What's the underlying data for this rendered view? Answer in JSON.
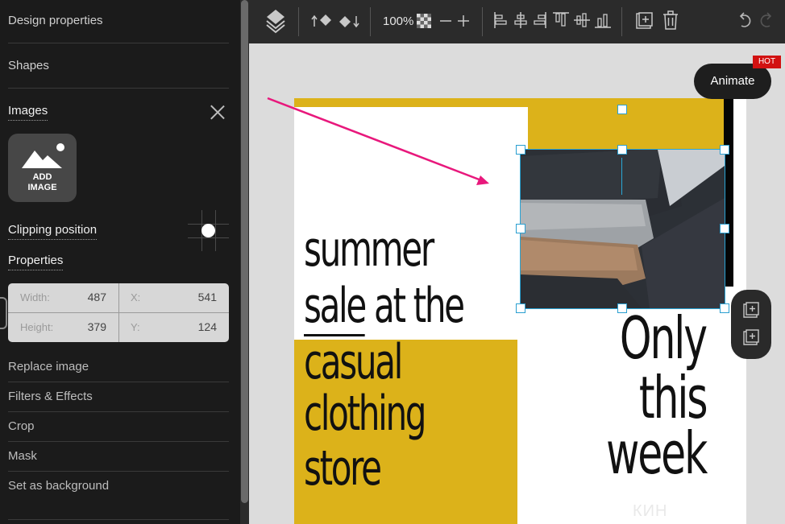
{
  "sidebar": {
    "design_properties": "Design properties",
    "shapes": "Shapes",
    "images": "Images",
    "add_image_line1": "ADD",
    "add_image_line2": "IMAGE",
    "clipping_position": "Clipping position",
    "properties": "Properties",
    "fields": {
      "width_label": "Width:",
      "width_value": "487",
      "x_label": "X:",
      "x_value": "541",
      "height_label": "Height:",
      "height_value": "379",
      "y_label": "Y:",
      "y_value": "124"
    },
    "actions": [
      "Replace image",
      "Filters & Effects",
      "Crop",
      "Mask",
      "Set as background"
    ]
  },
  "toolbar": {
    "zoom": "100%"
  },
  "canvas": {
    "headline": [
      "summer",
      "sale",
      "at the",
      "casual",
      "clothing",
      "store"
    ],
    "right_text": [
      "Only",
      "this",
      "week"
    ],
    "animate_label": "Animate",
    "hot_badge": "HOT",
    "watermark": "КИН"
  },
  "colors": {
    "accent_yellow": "#dcb21a",
    "selection_blue": "#2a9fd0",
    "arrow_pink": "#e8187c",
    "hot_red": "#d21111"
  }
}
